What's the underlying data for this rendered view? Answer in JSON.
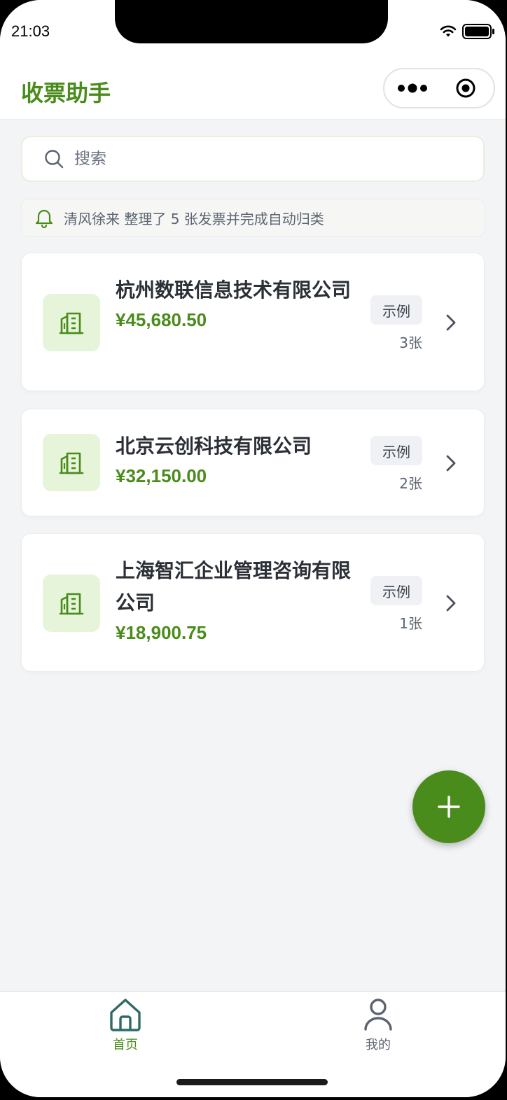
{
  "status_bar": {
    "time": "21:03",
    "icons": [
      "wifi-icon",
      "battery-icon"
    ]
  },
  "nav": {
    "title": "收票助手",
    "capsule_icons": [
      "more-dots-icon",
      "close-target-icon"
    ]
  },
  "search": {
    "placeholder": "搜索",
    "value": ""
  },
  "notice": {
    "icon": "bell-icon",
    "text": "清风徐来 整理了 5 张发票并完成自动归类"
  },
  "companies": [
    {
      "name": "杭州数联信息技术有限公司",
      "amount": "¥45,680.50",
      "tag": "示例",
      "count": "3张",
      "icon": "building-icon"
    },
    {
      "name": "北京云创科技有限公司",
      "amount": "¥32,150.00",
      "tag": "示例",
      "count": "2张",
      "icon": "building-icon"
    },
    {
      "name": "上海智汇企业管理咨询有限公司",
      "amount": "¥18,900.75",
      "tag": "示例",
      "count": "1张",
      "icon": "building-icon"
    }
  ],
  "fab": {
    "icon": "plus-icon"
  },
  "tabbar": {
    "items": [
      {
        "label": "首页",
        "icon": "home-icon",
        "active": true
      },
      {
        "label": "我的",
        "icon": "user-icon",
        "active": false
      }
    ]
  },
  "colors": {
    "brand": "#4a8c1c",
    "icon_bg": "#e6f4da",
    "tab_active_icon": "#2f6b63",
    "tab_inactive": "#5b6470",
    "background": "#f3f4f6"
  }
}
